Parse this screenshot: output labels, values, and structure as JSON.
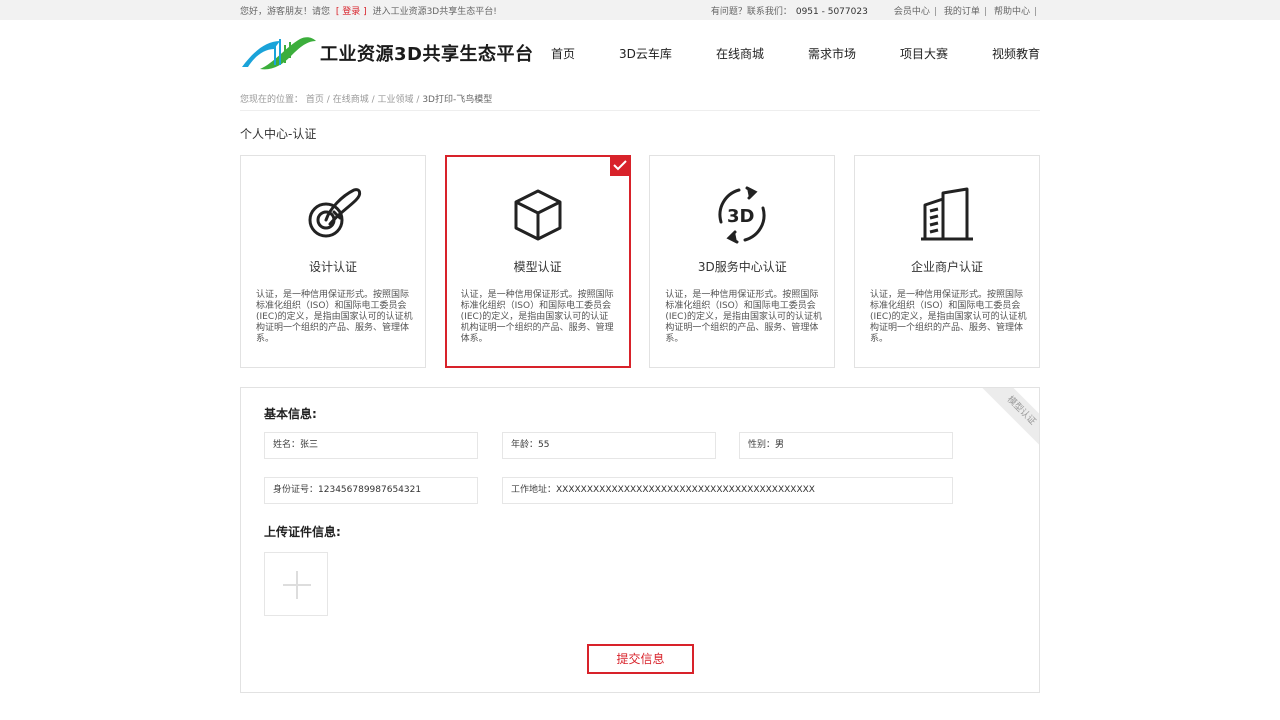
{
  "topbar": {
    "greeting": "您好，游客朋友！请您",
    "bracket_open": "[",
    "login": "登录",
    "bracket_close": "]",
    "welcome": "进入工业资源3D共享生态平台!",
    "question": "有问题？联系我们：",
    "phone": "0951 - 5077023",
    "links": [
      "会员中心",
      "我的订单",
      "帮助中心"
    ],
    "separator": "|"
  },
  "header": {
    "logo_text": "工业资源3D共享生态平台",
    "nav": [
      "首页",
      "3D云车库",
      "在线商城",
      "需求市场",
      "项目大赛",
      "视频教育"
    ]
  },
  "breadcrumb": {
    "prefix": "您现在的位置：",
    "items": [
      "首页",
      "在线商城",
      "工业领域",
      "3D打印-飞鸟模型"
    ],
    "separator": "/"
  },
  "page_title": "个人中心-认证",
  "cards": [
    {
      "title": "设计认证",
      "icon": "design-icon",
      "desc": "认证，是一种信用保证形式。按照国际标准化组织（ISO）和国际电工委员会(IEC)的定义，是指由国家认可的认证机构证明一个组织的产品、服务、管理体系。",
      "selected": false
    },
    {
      "title": "模型认证",
      "icon": "cube-icon",
      "desc": "认证，是一种信用保证形式。按照国际标准化组织（ISO）和国际电工委员会(IEC)的定义，是指由国家认可的认证机构证明一个组织的产品、服务、管理体系。",
      "selected": true
    },
    {
      "title": "3D服务中心认证",
      "icon": "3d-rotate-icon",
      "desc": "认证，是一种信用保证形式。按照国际标准化组织（ISO）和国际电工委员会(IEC)的定义，是指由国家认可的认证机构证明一个组织的产品、服务、管理体系。",
      "selected": false
    },
    {
      "title": "企业商户认证",
      "icon": "building-icon",
      "desc": "认证，是一种信用保证形式。按照国际标准化组织（ISO）和国际电工委员会(IEC)的定义，是指由国家认可的认证机构证明一个组织的产品、服务、管理体系。",
      "selected": false
    }
  ],
  "form": {
    "ribbon": "模型认证",
    "basic_info_label": "基本信息:",
    "name_label": "姓名：",
    "name_value": "张三",
    "age_label": "年龄：",
    "age_value": "55",
    "gender_label": "性别：",
    "gender_value": "男",
    "id_label": "身份证号：",
    "id_value": "123456789987654321",
    "address_label": "工作地址：",
    "address_value": "XXXXXXXXXXXXXXXXXXXXXXXXXXXXXXXXXXXXXXXXXX",
    "upload_label": "上传证件信息:",
    "submit": "提交信息"
  },
  "colors": {
    "accent": "#d8222a",
    "border": "#e2e2e2",
    "topbar_bg": "#f2f2f2"
  }
}
